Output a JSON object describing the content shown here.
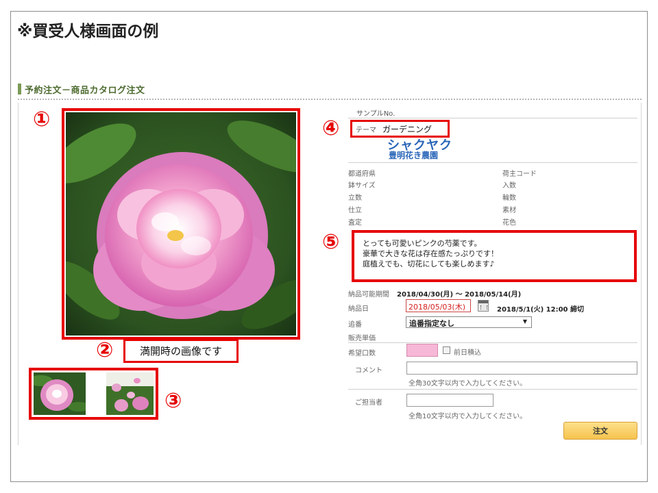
{
  "slide": {
    "title": "※買受人様画面の例"
  },
  "section": {
    "title": "予約注文－商品カタログ注文"
  },
  "callouts": {
    "n1": "①",
    "n2": "②",
    "n3": "③",
    "n4": "④",
    "n5": "⑤"
  },
  "image": {
    "caption": "満開時の画像です"
  },
  "product": {
    "sample_no_label": "サンプルNo.",
    "theme_label": "テーマ",
    "theme_value": "ガーデニング",
    "name": "シャクヤク",
    "farm": "豊明花き農園"
  },
  "specs": {
    "left": [
      "都道府県",
      "鉢サイズ",
      "立数",
      "仕立",
      "査定"
    ],
    "right": [
      "荷主コード",
      "入数",
      "輪数",
      "素材",
      "花色"
    ]
  },
  "description": {
    "lines": [
      "とっても可愛いピンクの芍薬です。",
      "豪華で大きな花は存在感たっぷりです！",
      "庭植えでも、切花にしても楽しめます♪"
    ]
  },
  "order": {
    "delivery_period_label": "納品可能期間",
    "delivery_period_value": "2018/04/30(月) ～ 2018/05/14(月)",
    "delivery_date_label": "納品日",
    "delivery_date_value": "2018/05/03(木)",
    "deadline": "2018/5/1(火) 12:00 締切",
    "extra_label": "追番",
    "extra_value": "追番指定なし",
    "price_label": "販売単価",
    "qty_label": "希望口数",
    "prev_day_label": "前日積込",
    "comment_label": "コメント",
    "comment_hint": "全角30文字以内で入力してください。",
    "contact_label": "ご担当者",
    "contact_hint": "全角10文字以内で入力してください。",
    "submit_label": "注文"
  },
  "colors": {
    "accent_red": "#e60000",
    "link_blue": "#2a66b8",
    "button_yellow": "#f6c34e",
    "qty_pink": "#f7b7d6"
  }
}
